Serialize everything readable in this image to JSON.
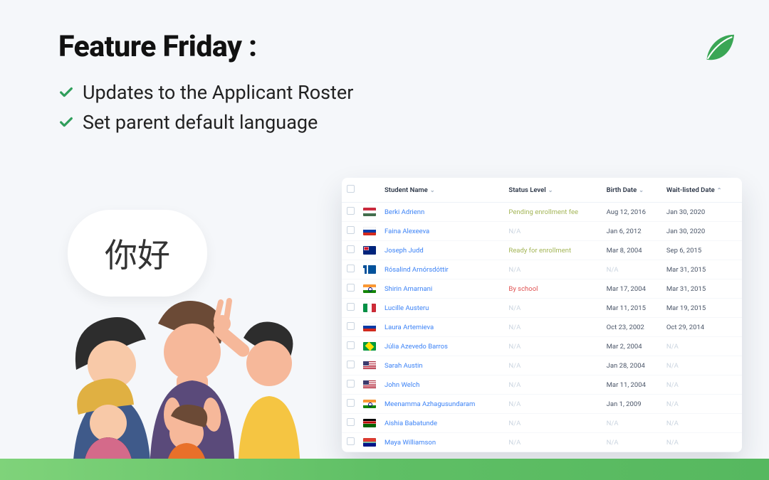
{
  "heading": "Feature Friday :",
  "bullets": [
    "Updates to the Applicant Roster",
    "Set parent default language"
  ],
  "bubble_text": "你好",
  "roster": {
    "columns": [
      "Student Name",
      "Status Level",
      "Birth Date",
      "Wait-listed Date"
    ],
    "rows": [
      {
        "flag": "hu",
        "name": "Berki Adrienn",
        "status": "Pending enrollment fee",
        "status_cls": "status-yg",
        "birth": "Aug 12, 2016",
        "wait": "Jan 30, 2020"
      },
      {
        "flag": "ru",
        "name": "Faina Alexeeva",
        "status": "N/A",
        "status_cls": "v-na",
        "birth": "Jan 6, 2012",
        "wait": "Jan 30, 2020"
      },
      {
        "flag": "au",
        "name": "Joseph Judd",
        "status": "Ready for enrollment",
        "status_cls": "status-yg",
        "birth": "Mar 8, 2004",
        "wait": "Sep 6, 2015"
      },
      {
        "flag": "is",
        "name": "Rósalind Arnórsdóttir",
        "status": "N/A",
        "status_cls": "v-na",
        "birth": "N/A",
        "wait": "Mar 31, 2015"
      },
      {
        "flag": "in",
        "name": "Shirin Amarnani",
        "status": "By school",
        "status_cls": "status-red",
        "birth": "Mar 17, 2004",
        "wait": "Mar 31, 2015"
      },
      {
        "flag": "it",
        "name": "Lucille Austeru",
        "status": "N/A",
        "status_cls": "v-na",
        "birth": "Mar 11, 2015",
        "wait": "Mar 19, 2015"
      },
      {
        "flag": "ru",
        "name": "Laura Artemieva",
        "status": "N/A",
        "status_cls": "v-na",
        "birth": "Oct 23, 2002",
        "wait": "Oct 29, 2014"
      },
      {
        "flag": "br",
        "name": "Júlia Azevedo Barros",
        "status": "N/A",
        "status_cls": "v-na",
        "birth": "Mar 2, 2004",
        "wait": "N/A"
      },
      {
        "flag": "us",
        "name": "Sarah Austin",
        "status": "N/A",
        "status_cls": "v-na",
        "birth": "Jan 28, 2004",
        "wait": "N/A"
      },
      {
        "flag": "us",
        "name": "John Welch",
        "status": "N/A",
        "status_cls": "v-na",
        "birth": "Mar 11, 2004",
        "wait": "N/A"
      },
      {
        "flag": "in",
        "name": "Meenamma Azhagusundaram",
        "status": "N/A",
        "status_cls": "v-na",
        "birth": "Jan 1, 2009",
        "wait": "N/A"
      },
      {
        "flag": "ke",
        "name": "Aishia Babatunde",
        "status": "N/A",
        "status_cls": "v-na",
        "birth": "N/A",
        "wait": "N/A"
      },
      {
        "flag": "za",
        "name": "Maya Williamson",
        "status": "N/A",
        "status_cls": "v-na",
        "birth": "N/A",
        "wait": "N/A"
      }
    ]
  }
}
